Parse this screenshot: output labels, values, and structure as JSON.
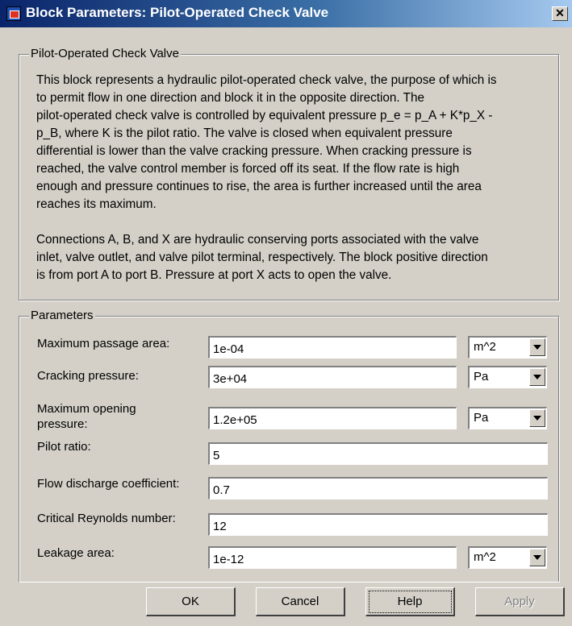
{
  "window": {
    "title": "Block Parameters: Pilot-Operated Check Valve",
    "close_glyph": "✕"
  },
  "description": {
    "legend": "Pilot-Operated Check Valve",
    "para1_lines": [
      "This block represents a hydraulic pilot-operated check valve, the purpose of which is",
      "to permit flow in one direction and block it in the opposite direction. The",
      "pilot-operated check valve is controlled by equivalent pressure p_e = p_A + K*p_X -",
      "p_B, where K is the pilot ratio. The valve is closed when equivalent pressure",
      "differential is lower than the valve cracking pressure. When cracking pressure is",
      "reached, the valve control member is forced off its seat. If the flow rate is high",
      "enough and pressure continues to rise, the area is further increased until the area",
      "reaches its maximum."
    ],
    "para2_lines": [
      "Connections A, B, and X are hydraulic conserving ports associated with the valve",
      "inlet, valve outlet, and valve pilot terminal, respectively. The block positive direction",
      "is from port A to port B. Pressure at port X acts to open the valve."
    ]
  },
  "parameters": {
    "legend": "Parameters",
    "max_area": {
      "label": "Maximum passage area:",
      "value": "1e-04",
      "unit": "m^2"
    },
    "cracking_pressure": {
      "label": "Cracking pressure:",
      "value": "3e+04",
      "unit": "Pa"
    },
    "max_opening_pressure": {
      "label_line1": "Maximum opening",
      "label_line2": "pressure:",
      "value": "1.2e+05",
      "unit": "Pa"
    },
    "pilot_ratio": {
      "label": "Pilot ratio:",
      "value": "5"
    },
    "flow_discharge": {
      "label": "Flow discharge coefficient:",
      "value": "0.7"
    },
    "critical_reynolds": {
      "label": "Critical Reynolds number:",
      "value": "12"
    },
    "leakage_area": {
      "label": "Leakage area:",
      "value": "1e-12",
      "unit": "m^2"
    }
  },
  "buttons": {
    "ok": "OK",
    "cancel": "Cancel",
    "help": "Help",
    "apply": "Apply"
  }
}
